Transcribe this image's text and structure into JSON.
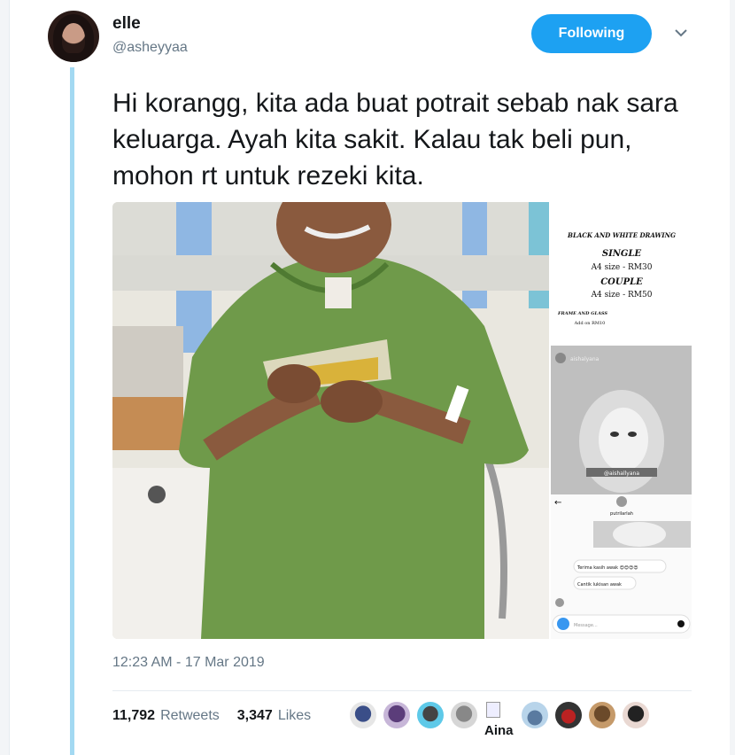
{
  "user": {
    "name": "elle",
    "handle": "@asheyyaa"
  },
  "follow_button": {
    "label": "Following"
  },
  "tweet": {
    "text": "Hi korangg, kita ada buat potrait sebab nak sara keluarga. Ayah kita sakit. Kalau tak beli pun, mohon rt untuk rezeki kita."
  },
  "media": {
    "price_card": {
      "heading": "BLACK AND WHITE DRAWING",
      "single_label": "SINGLE",
      "single_price": "A4 size - RM30",
      "couple_label": "COUPLE",
      "couple_price": "A4 size - RM50",
      "frame_label": "FRAME AND GLASS",
      "frame_price": "Add on RM10"
    },
    "story": {
      "username": "aishalyana",
      "watermark": "@aishallyana"
    },
    "dm": {
      "contact": "putrilarlah",
      "message_1": "Terima kasih awak 😍😍😍😍",
      "message_2": "Cantik lukisan awak",
      "placeholder": "Message..."
    }
  },
  "timestamp": "12:23 AM - 17 Mar 2019",
  "stats": {
    "retweets_count": "11,792",
    "retweets_label": "Retweets",
    "likes_count": "3,347",
    "likes_label": "Likes"
  },
  "likers": {
    "aina_label": "Aina"
  },
  "colors": {
    "accent": "#1da1f2",
    "thread_line": "#a3d9f2",
    "gown": "#6f9a4a"
  }
}
